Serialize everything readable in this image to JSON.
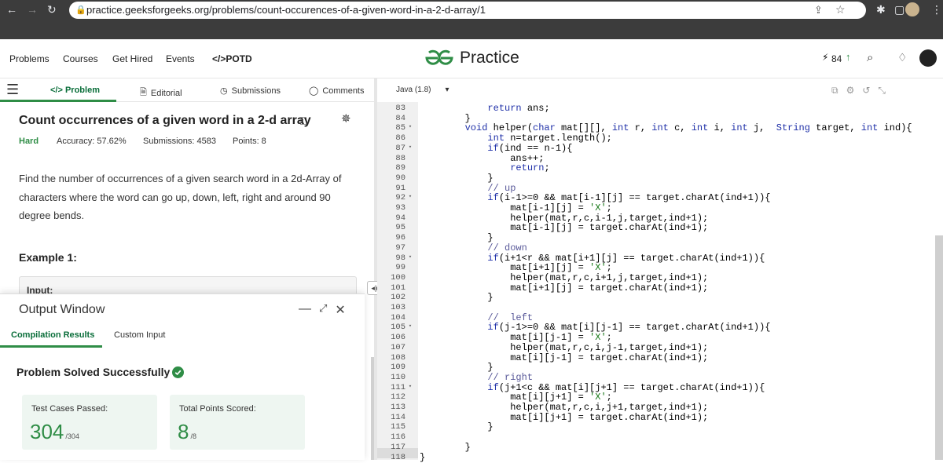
{
  "browser": {
    "url": "practice.geeksforgeeks.org/problems/count-occurences-of-a-given-word-in-a-2-d-array/1",
    "badge_count": "84"
  },
  "nav": {
    "links": [
      "Problems",
      "Courses",
      "Get Hired",
      "Events",
      "</>POTD"
    ],
    "logo_text": "Practice",
    "score": "84"
  },
  "problem": {
    "tabs": {
      "problem": "</> Problem",
      "editorial": "Editorial",
      "submissions": "Submissions",
      "comments": "Comments"
    },
    "title": "Count occurrences of a given word in a 2-d array",
    "difficulty": "Hard",
    "accuracy": "Accuracy: 57.62%",
    "submissions": "Submissions: 4583",
    "points": "Points: 8",
    "description": "Find the number of occurrences of a given search word in  a 2d-Array of characters where the word can go up, down, left, right and around 90 degree bends.",
    "example_label": "Example 1:",
    "input_label": "Input:"
  },
  "output": {
    "title": "Output Window",
    "tab_compile": "Compilation Results",
    "tab_custom": "Custom Input",
    "status": "Problem Solved Successfully",
    "test_label": "Test Cases Passed:",
    "test_value": "304",
    "test_total": "/304",
    "points_label": "Total Points Scored:",
    "points_value": "8",
    "points_total": "/8"
  },
  "editor": {
    "language": "Java (1.8)",
    "lines": [
      {
        "n": "83",
        "fold": false,
        "code": "            return ans;"
      },
      {
        "n": "84",
        "fold": false,
        "code": "        }"
      },
      {
        "n": "85",
        "fold": true,
        "code": "        void helper(char mat[][], int r, int c, int i, int j,  String target, int ind){"
      },
      {
        "n": "86",
        "fold": false,
        "code": "            int n=target.length();"
      },
      {
        "n": "87",
        "fold": true,
        "code": "            if(ind == n-1){"
      },
      {
        "n": "88",
        "fold": false,
        "code": "                ans++;"
      },
      {
        "n": "89",
        "fold": false,
        "code": "                return;"
      },
      {
        "n": "90",
        "fold": false,
        "code": "            }"
      },
      {
        "n": "91",
        "fold": false,
        "code": "            // up"
      },
      {
        "n": "92",
        "fold": true,
        "code": "            if(i-1>=0 && mat[i-1][j] == target.charAt(ind+1)){"
      },
      {
        "n": "93",
        "fold": false,
        "code": "                mat[i-1][j] = 'X';"
      },
      {
        "n": "94",
        "fold": false,
        "code": "                helper(mat,r,c,i-1,j,target,ind+1);"
      },
      {
        "n": "95",
        "fold": false,
        "code": "                mat[i-1][j] = target.charAt(ind+1);"
      },
      {
        "n": "96",
        "fold": false,
        "code": "            }"
      },
      {
        "n": "97",
        "fold": false,
        "code": "            // down"
      },
      {
        "n": "98",
        "fold": true,
        "code": "            if(i+1<r && mat[i+1][j] == target.charAt(ind+1)){"
      },
      {
        "n": "99",
        "fold": false,
        "code": "                mat[i+1][j] = 'X';"
      },
      {
        "n": "100",
        "fold": false,
        "code": "                helper(mat,r,c,i+1,j,target,ind+1);"
      },
      {
        "n": "101",
        "fold": false,
        "code": "                mat[i+1][j] = target.charAt(ind+1);"
      },
      {
        "n": "102",
        "fold": false,
        "code": "            }"
      },
      {
        "n": "103",
        "fold": false,
        "code": ""
      },
      {
        "n": "104",
        "fold": false,
        "code": "            //  left"
      },
      {
        "n": "105",
        "fold": true,
        "code": "            if(j-1>=0 && mat[i][j-1] == target.charAt(ind+1)){"
      },
      {
        "n": "106",
        "fold": false,
        "code": "                mat[i][j-1] = 'X';"
      },
      {
        "n": "107",
        "fold": false,
        "code": "                helper(mat,r,c,i,j-1,target,ind+1);"
      },
      {
        "n": "108",
        "fold": false,
        "code": "                mat[i][j-1] = target.charAt(ind+1);"
      },
      {
        "n": "109",
        "fold": false,
        "code": "            }"
      },
      {
        "n": "110",
        "fold": false,
        "code": "            // right"
      },
      {
        "n": "111",
        "fold": true,
        "code": "            if(j+1<c && mat[i][j+1] == target.charAt(ind+1)){"
      },
      {
        "n": "112",
        "fold": false,
        "code": "                mat[i][j+1] = 'X';"
      },
      {
        "n": "113",
        "fold": false,
        "code": "                helper(mat,r,c,i,j+1,target,ind+1);"
      },
      {
        "n": "114",
        "fold": false,
        "code": "                mat[i][j+1] = target.charAt(ind+1);"
      },
      {
        "n": "115",
        "fold": false,
        "code": "            }"
      },
      {
        "n": "116",
        "fold": false,
        "code": ""
      },
      {
        "n": "117",
        "fold": false,
        "code": "        }"
      },
      {
        "n": "118",
        "fold": false,
        "code": "}"
      }
    ]
  },
  "colors": {
    "accent": "#2f8d46",
    "chrome": "#3c3c3c"
  }
}
